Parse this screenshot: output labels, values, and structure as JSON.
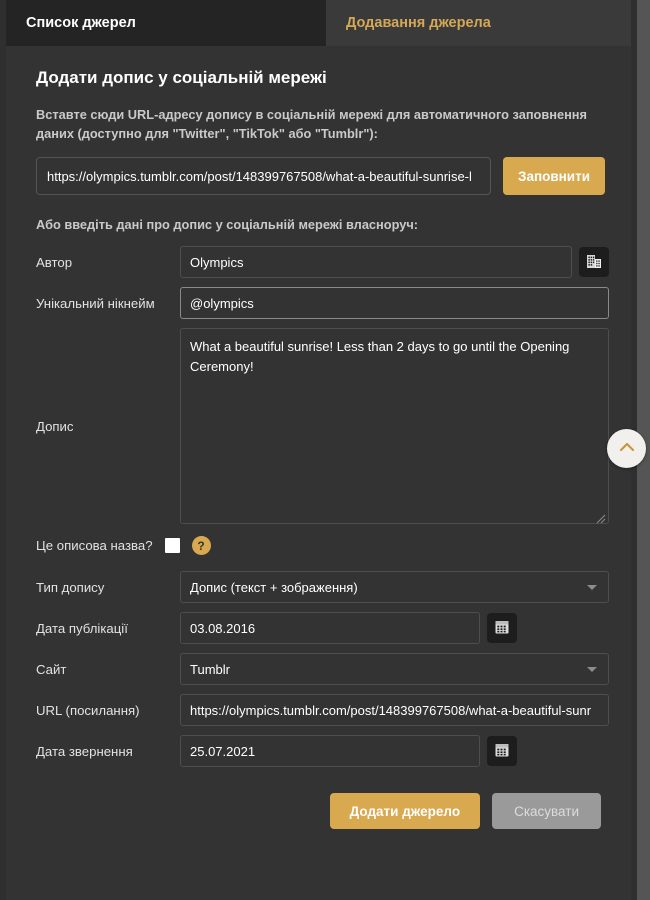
{
  "tabs": [
    {
      "label": "Список джерел",
      "active": true
    },
    {
      "label": "Додавання джерела",
      "active": false
    }
  ],
  "page": {
    "title": "Додати допис у соціальній мережі",
    "url_hint": "Вставте сюди URL-адресу допису в соціальній мережі для автоматичного заповнення даних (доступно для \"Twitter\", \"TikTok\" або \"Tumblr\"):",
    "manual_hint": "Або введіть дані про допис у соціальній мережі власноруч:"
  },
  "autofill": {
    "url_value": "https://olympics.tumblr.com/post/148399767508/what-a-beautiful-sunrise-l",
    "button_label": "Заповнити"
  },
  "fields": {
    "author": {
      "label": "Автор",
      "value": "Olympics",
      "icon": "organization-icon"
    },
    "nickname": {
      "label": "Унікальний нікнейм",
      "value": "@olympics"
    },
    "post": {
      "label": "Допис",
      "value": "What a beautiful sunrise! Less than 2 days to go until the Opening Ceremony!"
    },
    "descriptive": {
      "label": "Це описова назва?",
      "checked": false,
      "help_label": "?"
    },
    "post_type": {
      "label": "Тип допису",
      "value": "Допис (текст + зображення)"
    },
    "publish_date": {
      "label": "Дата публікації",
      "value": "03.08.2016",
      "icon": "calendar-icon"
    },
    "site": {
      "label": "Сайт",
      "value": "Tumblr"
    },
    "url": {
      "label": "URL (посилання)",
      "value": "https://olympics.tumblr.com/post/148399767508/what-a-beautiful-sunr"
    },
    "access_date": {
      "label": "Дата звернення",
      "value": "25.07.2021",
      "icon": "calendar-icon"
    }
  },
  "footer": {
    "submit_label": "Додати джерело",
    "cancel_label": "Скасувати"
  },
  "scroll_top": {
    "icon": "chevron-up-icon"
  },
  "colors": {
    "accent": "#d9a94f",
    "panel_bg": "#333333",
    "page_bg": "#3a3a3a",
    "active_tab_bg": "#242424",
    "text": "#ffffff",
    "muted_text": "#c9c9c9",
    "scrollbar_track": "#555555"
  }
}
